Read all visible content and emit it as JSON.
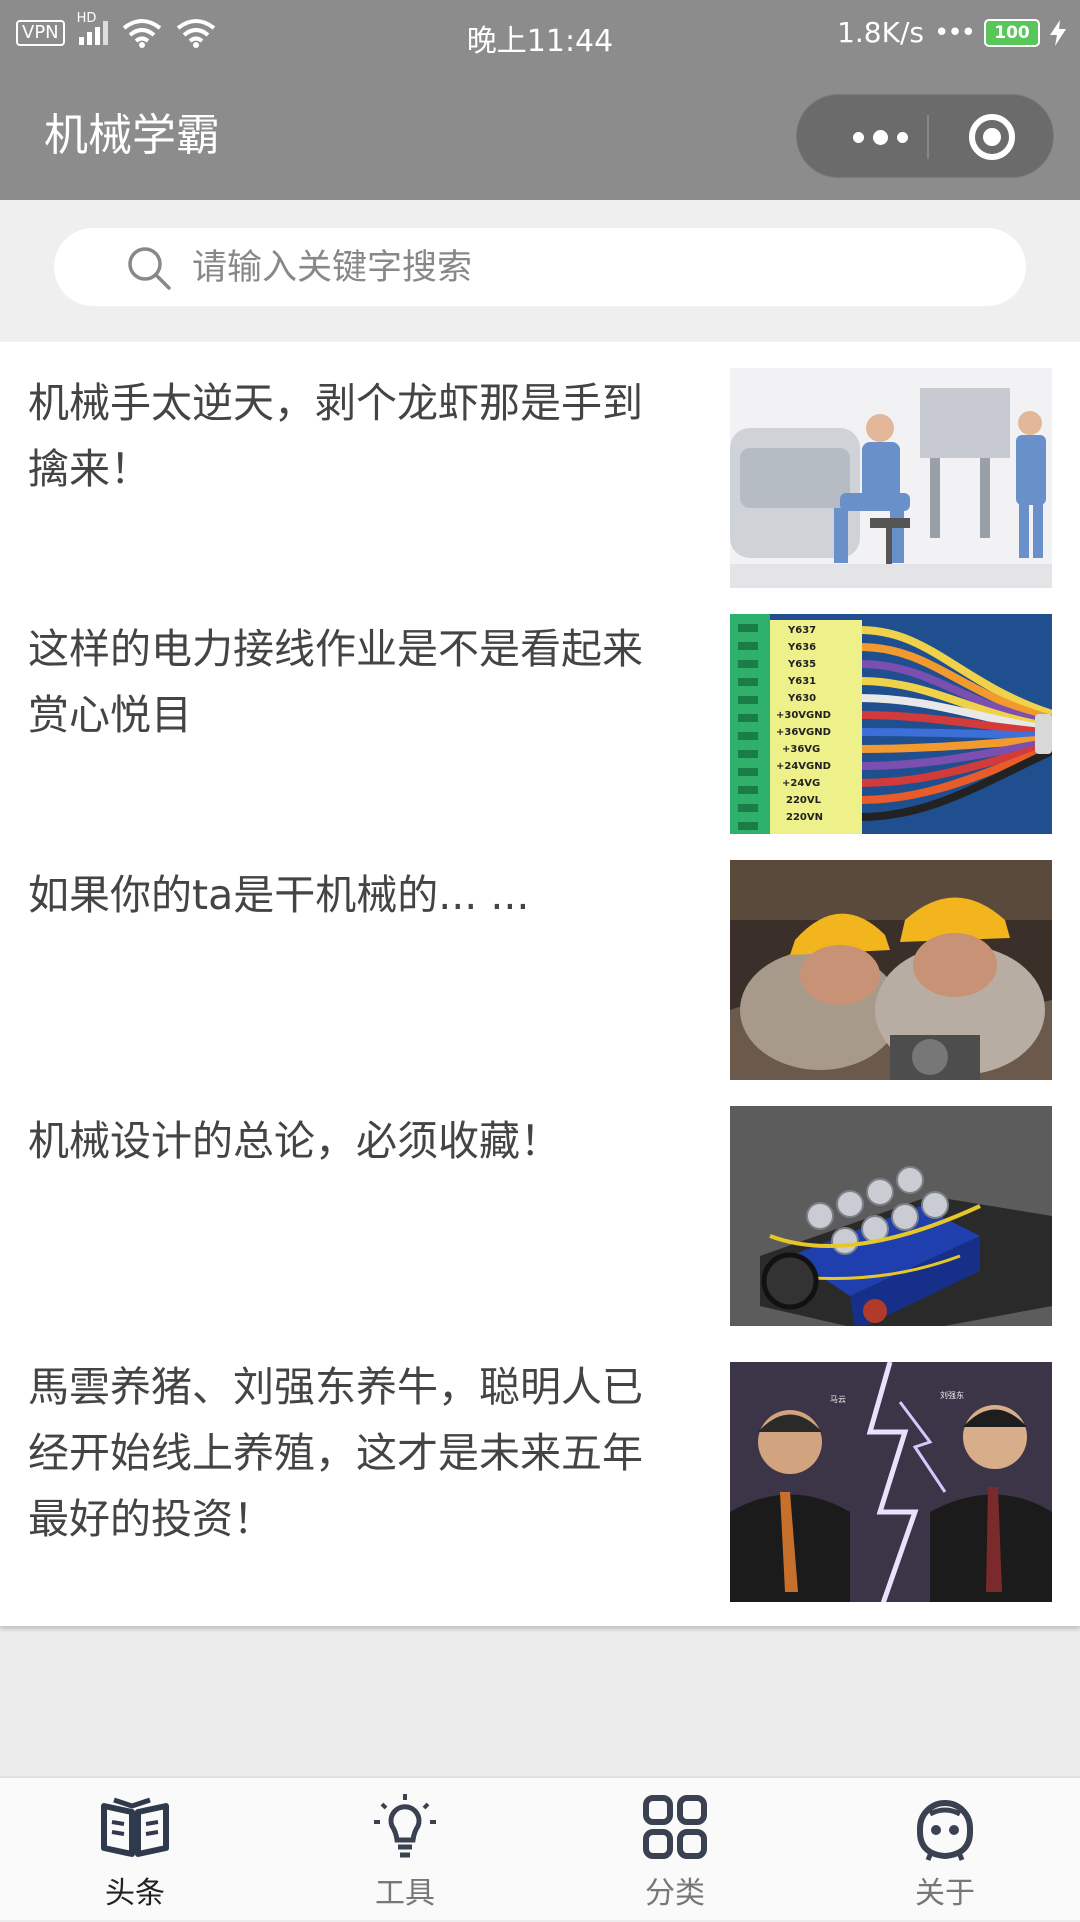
{
  "status_bar": {
    "vpn": "VPN",
    "hd": "HD",
    "time": "晚上11:44",
    "speed": "1.8K/s",
    "battery": "100"
  },
  "nav": {
    "title": "机械学霸"
  },
  "search": {
    "placeholder": "请输入关键字搜索"
  },
  "articles": [
    {
      "title": "机械手太逆天，剥个龙虾那是手到擒来！",
      "image": "surgical-robot-doctors"
    },
    {
      "title": "这样的电力接线作业是不是看起来赏心悦目",
      "image": "wiring-terminal-block",
      "wire_labels": [
        "Y637",
        "Y636",
        "Y635",
        "Y631",
        "Y630",
        "+30VGND",
        "+36VGND",
        "+36VG",
        "+24VGND",
        "+24VG",
        "220VL",
        "220VN"
      ]
    },
    {
      "title": "如果你的ta是干机械的... ...",
      "image": "workers-hardhats"
    },
    {
      "title": "机械设计的总论，必须收藏！",
      "image": "engine-3d-render"
    },
    {
      "title": "馬雲养猪、刘强东养牛，聪明人已经开始线上养殖，这才是未来五年最好的投资！",
      "image": "two-businessmen-lightning",
      "name_labels": [
        "马云",
        "刘强东"
      ]
    }
  ],
  "tabs": [
    {
      "label": "头条",
      "icon": "book-icon",
      "active": true
    },
    {
      "label": "工具",
      "icon": "lightbulb-icon",
      "active": false
    },
    {
      "label": "分类",
      "icon": "grid-icon",
      "active": false
    },
    {
      "label": "关于",
      "icon": "smiley-face-icon",
      "active": false
    }
  ],
  "colors": {
    "header": "#8c8c8c",
    "battery": "#59c659",
    "active_tab": "#2f3a4d"
  }
}
